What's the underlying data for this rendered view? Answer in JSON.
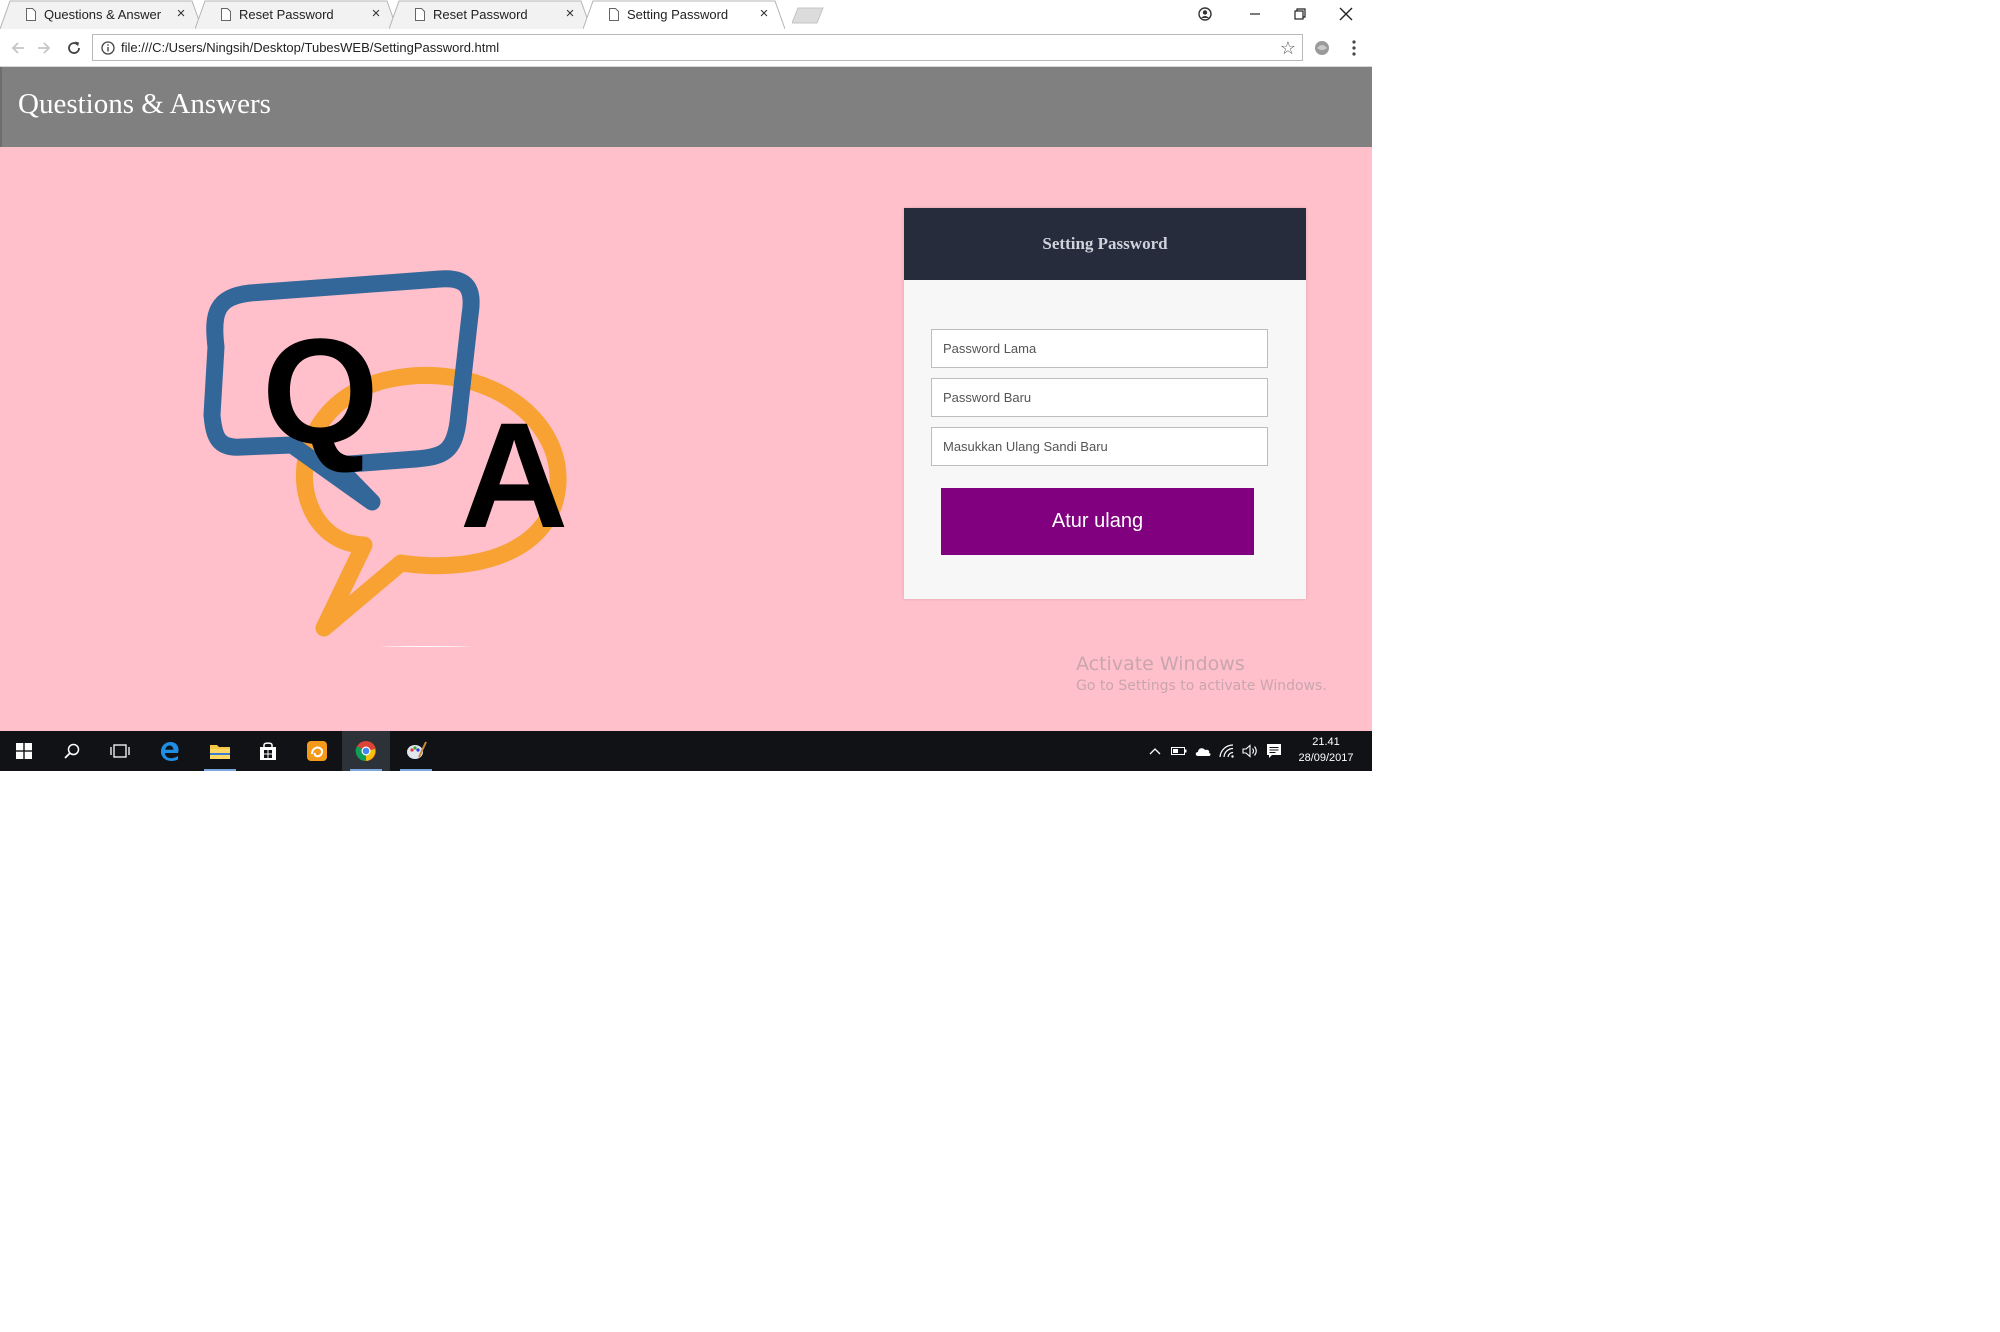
{
  "browser": {
    "tabs": [
      {
        "label": "Questions & Answer",
        "active": false
      },
      {
        "label": "Reset Password",
        "active": false
      },
      {
        "label": "Reset Password",
        "active": false
      },
      {
        "label": "Setting Password",
        "active": true
      }
    ],
    "url": "file:///C:/Users/Ningsih/Desktop/TubesWEB/SettingPassword.html"
  },
  "page": {
    "site_title": "Questions & Answers",
    "logo": {
      "q_letter": "Q",
      "a_letter": "A",
      "q_color": "#336699",
      "a_color": "#f7a233"
    },
    "card": {
      "title": "Setting Password",
      "fields": {
        "old_password_placeholder": "Password Lama",
        "new_password_placeholder": "Password Baru",
        "confirm_password_placeholder": "Masukkan Ulang Sandi Baru"
      },
      "submit_label": "Atur ulang"
    },
    "watermark": {
      "title": "Activate Windows",
      "subtitle": "Go to Settings to activate Windows."
    }
  },
  "taskbar": {
    "time": "21.41",
    "date": "28/09/2017"
  },
  "colors": {
    "page_background": "#ffc0cb",
    "header": "#808080",
    "card_header": "#262c3c",
    "button": "#800080"
  }
}
